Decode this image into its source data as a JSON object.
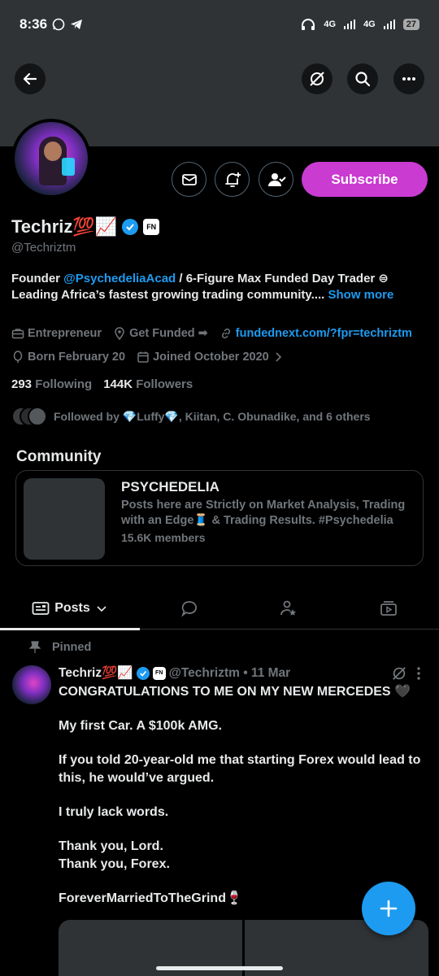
{
  "status_bar": {
    "time": "8:36",
    "network_1": "4G",
    "network_2": "4G",
    "battery": "27"
  },
  "profile": {
    "name": "Techriz💯📈",
    "affiliate_badge": "FN",
    "handle": "@Techriztm",
    "subscribe_label": "Subscribe",
    "bio_prefix": "Founder ",
    "bio_mention": "@PsychedeliaAcad",
    "bio_rest": " / 6-Figure Max Funded Day Trader ⊜ Leading Africa’s fastest growing trading community.... ",
    "bio_show_more": "Show more",
    "category": "Entrepreneur",
    "location": "Get Funded ➡",
    "website": "fundednext.com/?fpr=techriztm",
    "born": "Born February 20",
    "joined": "Joined October 2020",
    "following_count": "293",
    "following_label": "Following",
    "followers_count": "144K",
    "followers_label": "Followers",
    "followed_by": "Followed by 💎Luffy💎, Kiitan, C. Obunadike, and 6 others"
  },
  "community": {
    "section_title": "Community",
    "name": "PSYCHEDELIA",
    "description": "Posts here are Strictly on Market Analysis, Trading with an Edge🧵 & Trading Results. #Psychedelia",
    "members": "15.6K members"
  },
  "tabs": {
    "posts_label": "Posts"
  },
  "post": {
    "pinned_label": "Pinned",
    "author_name": "Techriz💯📈",
    "affiliate_badge": "FN",
    "handle_date": "@Techriztm • 11 Mar",
    "line1": "CONGRATULATIONS TO ME ON MY NEW MERCEDES 🖤",
    "line2": "My first Car. A $100k AMG.",
    "line3": "If you told 20-year-old me that starting Forex would lead to this, he would’ve argued.",
    "line4": "I truly lack words.",
    "line5": "Thank you, Lord.",
    "line6": "Thank you, Forex.",
    "line7": "ForeverMarriedToTheGrind🍷"
  },
  "colors": {
    "accent": "#1d9bf0",
    "subscribe": "#c93bd1",
    "muted": "#71767b",
    "text": "#e7e9ea",
    "background": "#000000"
  }
}
